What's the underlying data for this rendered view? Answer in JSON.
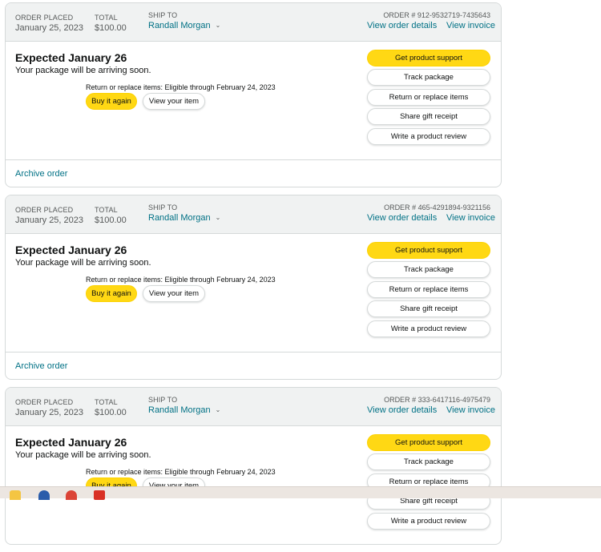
{
  "header_labels": {
    "order_placed": "ORDER PLACED",
    "total": "TOTAL",
    "ship_to": "SHIP TO",
    "view_order_details": "View order details",
    "view_invoice": "View invoice"
  },
  "body_labels": {
    "return_prefix": "Return or replace items: Eligible through February 24, 2023",
    "buy_again": "Buy it again",
    "view_item": "View your item",
    "archive": "Archive order"
  },
  "orders": [
    {
      "date": "January 25, 2023",
      "total": "$100.00",
      "ship_to": "Randall Morgan",
      "order_number": "ORDER # 912-9532719-7435643",
      "expected": "Expected January 26",
      "arriving": "Your package will be arriving soon.",
      "actions": [
        "Get product support",
        "Track package",
        "Return or replace items",
        "Share gift receipt",
        "Write a product review"
      ]
    },
    {
      "date": "January 25, 2023",
      "total": "$100.00",
      "ship_to": "Randall Morgan",
      "order_number": "ORDER # 465-4291894-9321156",
      "expected": "Expected January 26",
      "arriving": "Your package will be arriving soon.",
      "actions": [
        "Get product support",
        "Track package",
        "Return or replace items",
        "Share gift receipt",
        "Write a product review"
      ]
    },
    {
      "date": "January 25, 2023",
      "total": "$100.00",
      "ship_to": "Randall Morgan",
      "order_number": "ORDER # 333-6417116-4975479",
      "expected": "Expected January 26",
      "arriving": "Your package will be arriving soon.",
      "actions": [
        "Get product support",
        "Track package",
        "Return or replace items",
        "Share gift receipt",
        "Write a product review"
      ]
    }
  ],
  "colors": {
    "primary_button": "#ffd814",
    "link": "#007185",
    "header_bg": "#f0f2f2"
  },
  "taskbar_icons": [
    "file-explorer-icon",
    "edge-icon",
    "chrome-icon",
    "app-icon"
  ]
}
